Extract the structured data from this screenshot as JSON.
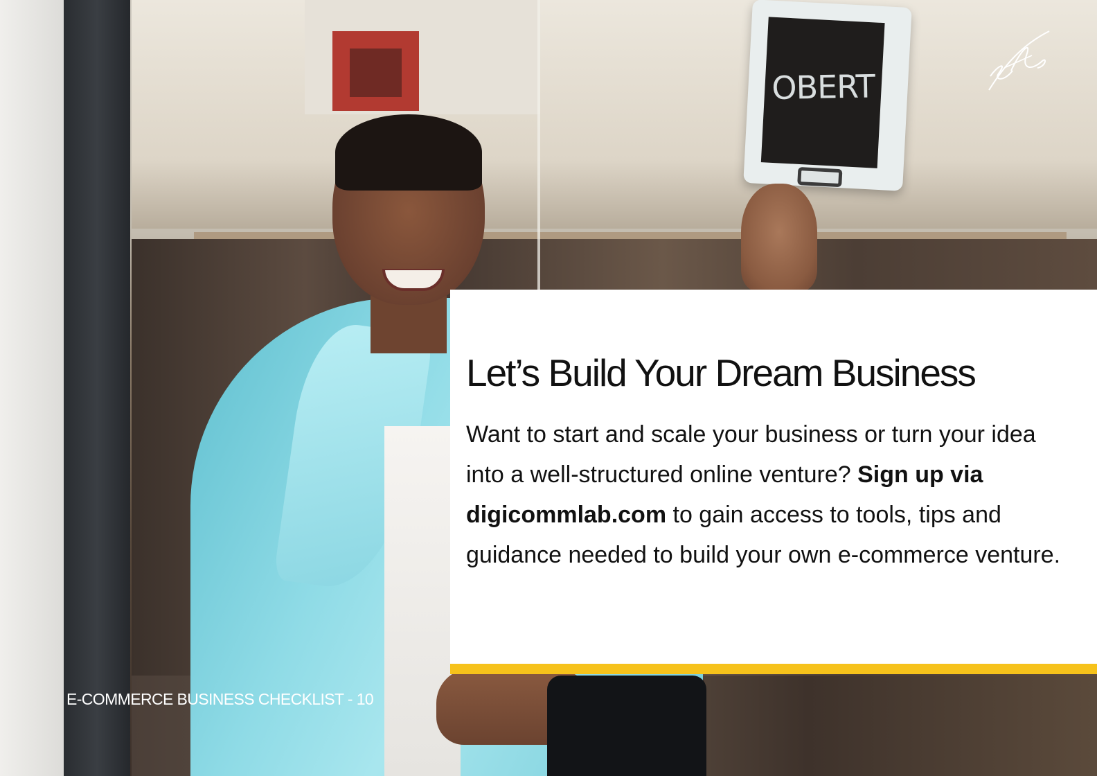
{
  "photo": {
    "sign_text": "OBERT"
  },
  "card": {
    "title": "Let’s Build Your Dream Business",
    "body_intro": "Want to start and scale your business or turn your idea into a well-structured online venture? ",
    "body_bold": "Sign up via digicommlab.com",
    "body_rest": " to gain access to tools, tips and guidance needed to build your own e-commerce venture."
  },
  "footer": {
    "label": "E-COMMERCE BUSINESS CHECKLIST - 10"
  },
  "colors": {
    "accent_bar": "#f6c21b",
    "card_background": "#ffffff",
    "text": "#111111"
  },
  "icons": {
    "signature": "handwritten-signature-logo"
  }
}
